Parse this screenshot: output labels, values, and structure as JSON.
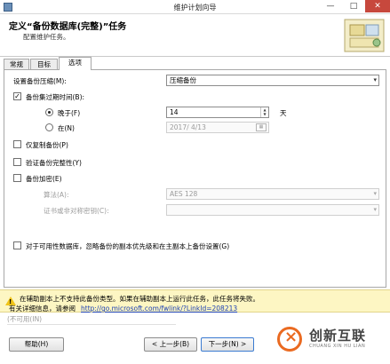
{
  "window": {
    "title": "维护计划向导",
    "min_glyph": "—",
    "max_glyph": "□",
    "close_glyph": "✕"
  },
  "header": {
    "title": "定义“备份数据库(完整)”任务",
    "subtitle": "配置维护任务。"
  },
  "tabs": [
    {
      "label": "常规",
      "active": false
    },
    {
      "label": "目标",
      "active": false
    },
    {
      "label": "选项",
      "active": true
    }
  ],
  "options": {
    "compression": {
      "label": "设置备份压缩(M):",
      "value": "压缩备份",
      "arrow": "▾"
    },
    "expire": {
      "label": "备份集过期时间(B):",
      "checked": true,
      "after": {
        "label": "晚于(F)",
        "selected": true,
        "value": "14",
        "unit": "天",
        "spin_up": "▲",
        "spin_down": "▼"
      },
      "on": {
        "label": "在(N)",
        "selected": false,
        "value": "2017/ 4/13",
        "cal_glyph": "▦"
      }
    },
    "copy_only": {
      "label": "仅复制备份(P)",
      "checked": false
    },
    "verify": {
      "label": "验证备份完整性(Y)",
      "checked": false
    },
    "encryption": {
      "label": "备份加密(E)",
      "checked": false,
      "algorithm": {
        "label": "算法(A):",
        "value": "AES 128",
        "arrow": "▾"
      },
      "certificate": {
        "label": "证书或非对称密钥(C):",
        "value": "",
        "arrow": "▾"
      }
    },
    "availability": {
      "label": "对于可用性数据库，忽略备份的副本优先级和在主副本上备份设置(G)",
      "checked": false
    },
    "check_glyph": "✓"
  },
  "warning": {
    "icon": "!",
    "line1": "在辅助副本上不支持此备份类型。如果在辅助副本上运行此任务，此任务将失败。",
    "line2": "有关详细信息，请参阅",
    "link": "http://go.microsoft.com/fwlink/?LinkId=208213"
  },
  "hidden_field": "(不可用(IN)",
  "buttons": {
    "help": "帮助(H)",
    "back": "< 上一步(B)",
    "next": "下一步(N) >"
  },
  "watermark": {
    "brand": "创新互联",
    "sub": "CHUANG XIN HU LIAN"
  },
  "colors": {
    "warning_bg": "#fdf6c3",
    "link": "#1a3fb4",
    "close_button": "#c7483d",
    "brand_orange": "#ea6a21"
  }
}
